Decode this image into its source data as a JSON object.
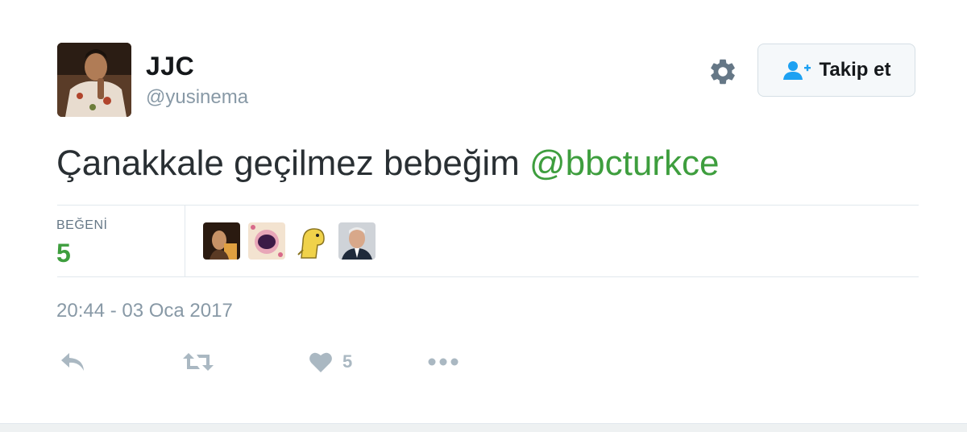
{
  "user": {
    "display_name": "JJC",
    "screen_name": "@yusinema",
    "avatar_icon": "user-avatar"
  },
  "header": {
    "settings_icon": "gear-icon",
    "follow_label": "Takip et",
    "follow_icon": "user-plus-icon"
  },
  "tweet": {
    "text": "Çanakkale geçilmez bebeğim",
    "mention": "@bbcturkce",
    "mention_color": "#3e9e3e"
  },
  "stats": {
    "likes_label": "BEĞENİ",
    "likes_count": "5"
  },
  "timestamp": "20:44 - 03 Oca 2017",
  "actions": {
    "reply_icon": "reply-icon",
    "retweet_icon": "retweet-icon",
    "like_icon": "heart-icon",
    "like_count": "5",
    "more_icon": "more-dots-icon"
  },
  "colors": {
    "text": "#292f33",
    "secondary": "#8899a6",
    "accent": "#3e9e3e",
    "icon_gray": "#aab8c2"
  }
}
